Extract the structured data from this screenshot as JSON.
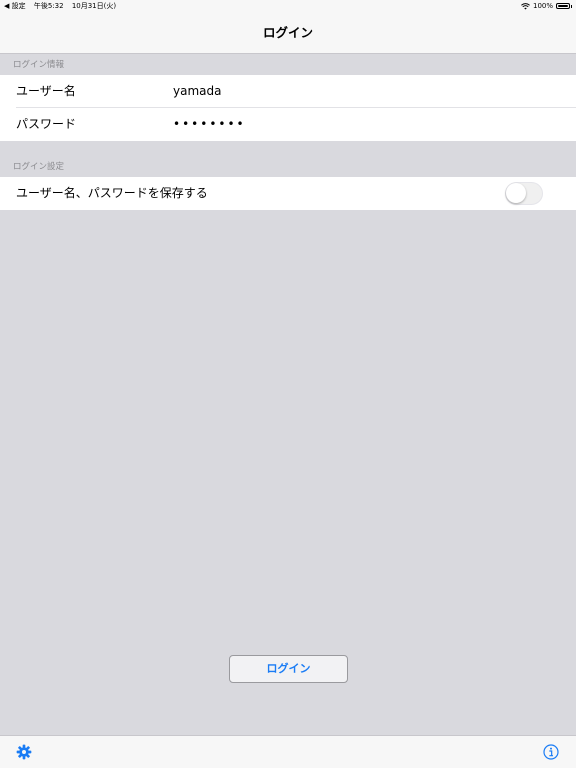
{
  "status_bar": {
    "back_label": "◀ 設定",
    "time": "午後5:32",
    "date": "10月31日(火)",
    "battery": "100%",
    "wifi_icon": "wifi-icon",
    "battery_icon": "battery-icon"
  },
  "nav": {
    "title": "ログイン"
  },
  "login_info": {
    "header": "ログイン情報",
    "username_label": "ユーザー名",
    "username_value": "yamada",
    "password_label": "パスワード",
    "password_value": "••••••••"
  },
  "login_settings": {
    "header": "ログイン設定",
    "save_label": "ユーザー名、パスワードを保存する",
    "save_enabled": false
  },
  "login_button": {
    "label": "ログイン"
  },
  "toolbar": {
    "settings_icon": "gear-icon",
    "info_icon": "info-icon"
  },
  "colors": {
    "accent": "#1a7cf5",
    "background": "#d9d9de",
    "bar": "#f7f7f7"
  }
}
